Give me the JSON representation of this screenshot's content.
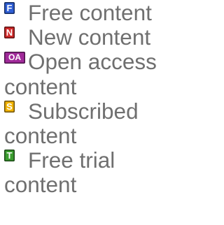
{
  "legend": {
    "items": [
      {
        "badge": "F",
        "badge_color": "#2f5fd6",
        "label": "Free content"
      },
      {
        "badge": "N",
        "badge_color": "#d12a2a",
        "label": "New content"
      },
      {
        "badge": "OA",
        "badge_color": "#a12a9a",
        "label": "Open access content"
      },
      {
        "badge": "S",
        "badge_color": "#f2b400",
        "label": "Subscribed content"
      },
      {
        "badge": "T",
        "badge_color": "#3b9d2f",
        "label": "Free trial content"
      }
    ]
  }
}
